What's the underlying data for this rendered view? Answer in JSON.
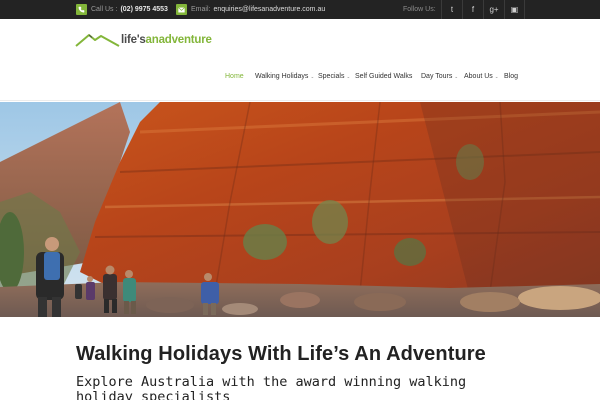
{
  "topbar": {
    "phone_label": "Call Us :",
    "phone_value": "(02) 9975 4553",
    "email_label": "Email:",
    "email_value": "enquiries@lifesanadventure.com.au",
    "follow_label": "Follow Us:",
    "social": [
      {
        "name": "twitter",
        "glyph": "t"
      },
      {
        "name": "facebook",
        "glyph": "f"
      },
      {
        "name": "google-plus",
        "glyph": "g+"
      },
      {
        "name": "instagram",
        "glyph": "▣"
      }
    ],
    "accent": "#83b63a"
  },
  "logo": {
    "text_part1": "life's",
    "text_part2": "anadventure"
  },
  "nav": {
    "items": [
      {
        "label": "Home",
        "active": true,
        "dropdown": false
      },
      {
        "label": "Walking Holidays",
        "active": false,
        "dropdown": true
      },
      {
        "label": "Specials",
        "active": false,
        "dropdown": true
      },
      {
        "label": "Self Guided Walks",
        "active": false,
        "dropdown": false
      },
      {
        "label": "Day Tours",
        "active": false,
        "dropdown": true
      },
      {
        "label": "About Us",
        "active": false,
        "dropdown": true
      },
      {
        "label": "Blog",
        "active": false,
        "dropdown": false
      }
    ],
    "caret": "⌄"
  },
  "main": {
    "title": "Walking Holidays With Life’s An Adventure",
    "subtitle": "Explore Australia with the award winning walking holiday specialists"
  }
}
